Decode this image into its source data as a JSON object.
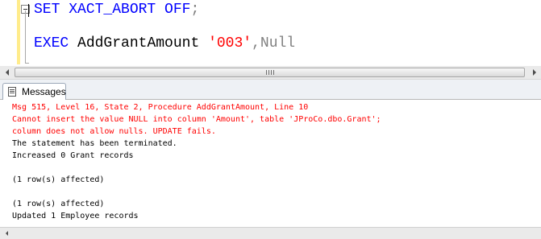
{
  "editor": {
    "line1": {
      "keyword": "SET XACT_ABORT OFF",
      "terminator": ";"
    },
    "line2": {
      "exec_keyword": "EXEC",
      "procedure": "AddGrantAmount",
      "arg_string": "'003'",
      "comma": ",",
      "arg_null": "Null"
    }
  },
  "tabs": [
    {
      "label": "Messages",
      "icon": "messages-icon",
      "selected": true
    }
  ],
  "messages": [
    {
      "text": "Msg 515, Level 16, State 2, Procedure AddGrantAmount, Line 10",
      "type": "error"
    },
    {
      "text": "Cannot insert the value NULL into column 'Amount', table 'JProCo.dbo.Grant';",
      "type": "error"
    },
    {
      "text": "column does not allow nulls. UPDATE fails.",
      "type": "error"
    },
    {
      "text": "The statement has been terminated.",
      "type": "info"
    },
    {
      "text": "Increased 0 Grant records",
      "type": "info"
    },
    {
      "text": "",
      "type": "info"
    },
    {
      "text": "(1 row(s) affected)",
      "type": "info"
    },
    {
      "text": "",
      "type": "info"
    },
    {
      "text": "(1 row(s) affected)",
      "type": "info"
    },
    {
      "text": "Updated 1 Employee records",
      "type": "info"
    }
  ],
  "colors": {
    "keyword": "#0000ff",
    "string": "#ff0000",
    "error_text": "#ff0000",
    "null_literal": "#808080",
    "change_marker": "#ffec8b"
  }
}
